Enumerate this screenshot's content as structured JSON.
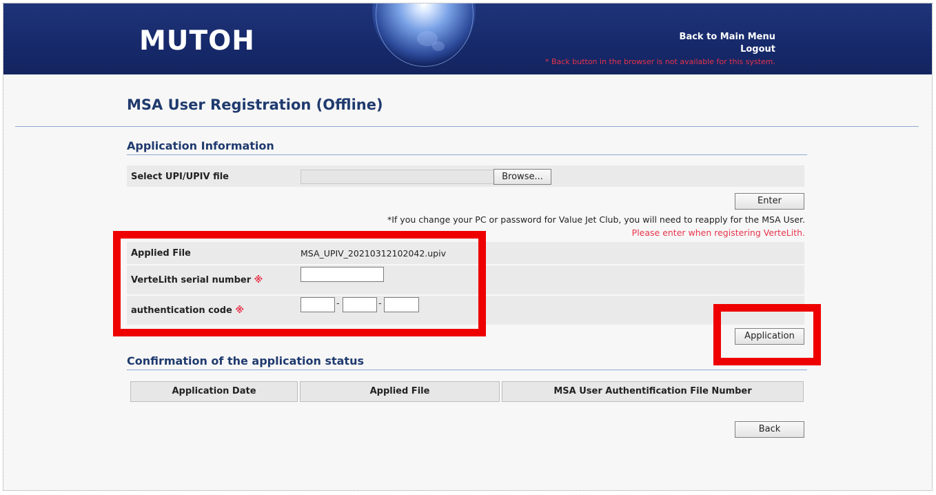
{
  "header": {
    "logo": "MUTOH",
    "back_to_main_menu": "Back to Main Menu",
    "logout": "Logout",
    "note": "* Back button in the browser is not available for this system."
  },
  "page": {
    "title": "MSA User Registration (Offline)"
  },
  "application_info": {
    "section_title": "Application Information",
    "select_file_label": "Select UPI/UPIV file",
    "browse_label": "Browse...",
    "enter_label": "Enter",
    "note_reapply": "*If you change your PC or password for Value Jet Club, you will need to reapply for the MSA User.",
    "note_vertelith": "Please enter when registering VerteLith.",
    "applied_file_label": "Applied File",
    "applied_file_value": "MSA_UPIV_20210312102042.upiv",
    "serial_label": "VerteLith serial number",
    "auth_code_label": "authentication code",
    "required_mark": "※",
    "code_separator": "-",
    "serial_value": "",
    "auth_code_values": [
      "",
      "",
      ""
    ],
    "application_label": "Application"
  },
  "status": {
    "section_title": "Confirmation of the application status",
    "columns": [
      "Application Date",
      "Applied File",
      "MSA User Authentification File Number"
    ],
    "rows": [],
    "back_label": "Back"
  },
  "colors": {
    "header_bg": "#16296a",
    "title_blue": "#1f3a6e",
    "required_red": "#e8334a",
    "highlight_red": "#ee0000"
  }
}
